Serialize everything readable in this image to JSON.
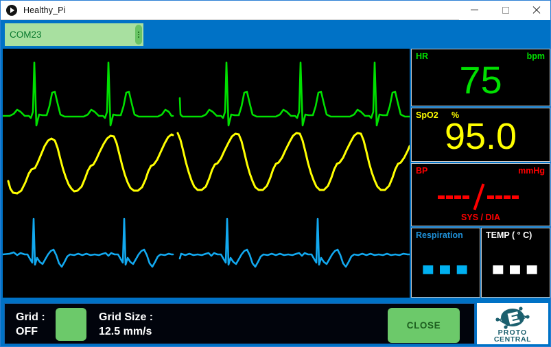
{
  "window": {
    "title": "Healthy_Pi",
    "app_icon": "play-circle-icon",
    "minimize_label": "–",
    "maximize_label": "□",
    "close_label": "✕"
  },
  "toolbar": {
    "port_selector": {
      "value": "COM23",
      "handle_icon": "drag-handle-dots-icon"
    }
  },
  "vitals": {
    "hr": {
      "label": "HR",
      "unit": "bpm",
      "value": "75",
      "color": "#00e000"
    },
    "spo2": {
      "label": "SpO2",
      "unit": "%",
      "value": "95.0",
      "color": "#ffff00"
    },
    "bp": {
      "label": "BP",
      "unit": "mmHg",
      "value": "--- / ---",
      "sublabel": "SYS  /  DIA",
      "color": "#ff0000"
    },
    "respiration": {
      "label": "Respiration",
      "value": "▀ ▀ ▀",
      "color": "#00b0f0"
    },
    "temp": {
      "label": "TEMP ( ° C)",
      "value": "▀ ▀ ▀",
      "color": "#ffffff"
    }
  },
  "waveforms": {
    "ecg": {
      "name": "ecg-trace",
      "color": "#00e000"
    },
    "pleth": {
      "name": "pleth-trace",
      "color": "#ffff00"
    },
    "respiration": {
      "name": "respiration-trace",
      "color": "#12a9f0"
    }
  },
  "bottom_bar": {
    "grid_label": "Grid :",
    "grid_state": "OFF",
    "grid_toggle_color": "#6cc96a",
    "grid_size_label": "Grid Size :",
    "grid_size_value": "12.5 mm/s",
    "close_label": "CLOSE",
    "brand_line1": "PROTO",
    "brand_line2": "CENTRAL"
  }
}
